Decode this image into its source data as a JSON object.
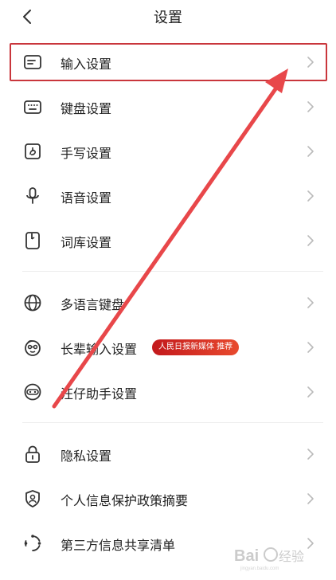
{
  "header": {
    "title": "设置"
  },
  "groups": [
    [
      {
        "label": "输入设置",
        "icon": "input-box-icon"
      },
      {
        "label": "键盘设置",
        "icon": "keyboard-icon"
      },
      {
        "label": "手写设置",
        "icon": "handwriting-icon"
      },
      {
        "label": "语音设置",
        "icon": "microphone-icon"
      },
      {
        "label": "词库设置",
        "icon": "dictionary-icon"
      }
    ],
    [
      {
        "label": "多语言键盘",
        "icon": "globe-icon"
      },
      {
        "label": "长辈输入设置",
        "icon": "elder-face-icon",
        "badge": "人民日报新媒体 推荐"
      },
      {
        "label": "汪仔助手设置",
        "icon": "assistant-mascot-icon"
      }
    ],
    [
      {
        "label": "隐私设置",
        "icon": "lock-icon"
      },
      {
        "label": "个人信息保护政策摘要",
        "icon": "shield-person-icon"
      },
      {
        "label": "第三方信息共享清单",
        "icon": "share-cycle-icon"
      }
    ]
  ],
  "highlight": {
    "color": "#c9363c",
    "target": "输入设置"
  },
  "annotation_arrow_color": "#e8474a",
  "watermark_logo": "Baidu经验"
}
